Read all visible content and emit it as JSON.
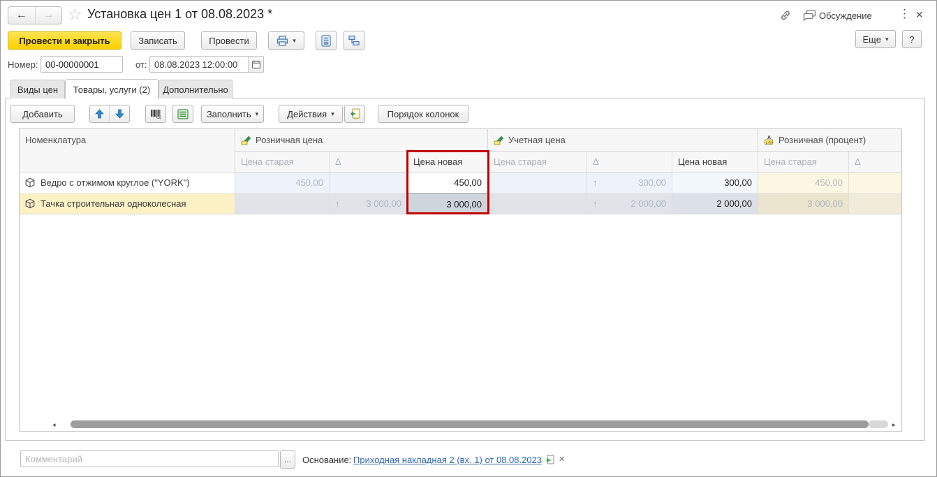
{
  "window": {
    "title": "Установка цен 1 от 08.08.2023 *",
    "discussion_label": "Обсуждение",
    "back_glyph": "←",
    "forward_glyph": "→",
    "star_glyph": "☆",
    "kebab_glyph": "⋮",
    "close_glyph": "✕"
  },
  "toolbar": {
    "post_and_close": "Провести и закрыть",
    "write": "Записать",
    "post": "Провести",
    "more": "Еще",
    "help": "?",
    "caret": "▾"
  },
  "doc_fields": {
    "number_label": "Номер:",
    "number_value": "00-00000001",
    "date_label": "от:",
    "date_value": "08.08.2023 12:00:00"
  },
  "tabs": [
    {
      "label": "Виды цен"
    },
    {
      "label": "Товары, услуги (2)"
    },
    {
      "label": "Дополнительно"
    }
  ],
  "table_toolbar": {
    "add": "Добавить",
    "fill": "Заполнить",
    "actions": "Действия",
    "column_order": "Порядок колонок",
    "caret": "▾"
  },
  "table": {
    "nomenclature_header": "Номенклатура",
    "groups": [
      {
        "label": "Розничная цена",
        "cols": [
          "Цена старая",
          "Δ",
          "Цена новая"
        ]
      },
      {
        "label": "Учетная цена",
        "cols": [
          "Цена старая",
          "Δ",
          "Цена новая"
        ]
      },
      {
        "label": "Розничная (процент)",
        "cols": [
          "Цена старая",
          "Δ"
        ]
      }
    ],
    "rows": [
      {
        "name": "Ведро с отжимом круглое (\"YORK\")",
        "retail_old": "450,00",
        "retail_delta_arrow": "",
        "retail_delta": "",
        "retail_new": "450,00",
        "account_old": "",
        "account_delta_arrow": "↑",
        "account_delta": "300,00",
        "account_new": "300,00",
        "percent_old": "450,00",
        "percent_delta": ""
      },
      {
        "name": "Тачка строительная одноколесная",
        "retail_old": "",
        "retail_delta_arrow": "↑",
        "retail_delta": "3 000,00",
        "retail_new": "3 000,00",
        "account_old": "",
        "account_delta_arrow": "↑",
        "account_delta": "2 000,00",
        "account_new": "2 000,00",
        "percent_old": "3 000,00",
        "percent_delta": ""
      }
    ]
  },
  "scrollbar": {
    "left_glyph": "◂",
    "right_glyph": "▸"
  },
  "footer": {
    "comment_placeholder": "Комментарий",
    "ellipsis": "...",
    "basis_label": "Основание:",
    "basis_link": "Приходная накладная 2 (вх. 1) от 08.08.2023",
    "clear_glyph": "✕"
  },
  "colors": {
    "accent_yellow": "#fed000",
    "highlight_red": "#c00000",
    "link_blue": "#3069aa",
    "row_readonly_blue": "#edf3f9",
    "row_selected_gray": "#e0e4e9",
    "row_current_yellow": "#fcf1c5",
    "percent_cream": "#fcf7e3"
  }
}
